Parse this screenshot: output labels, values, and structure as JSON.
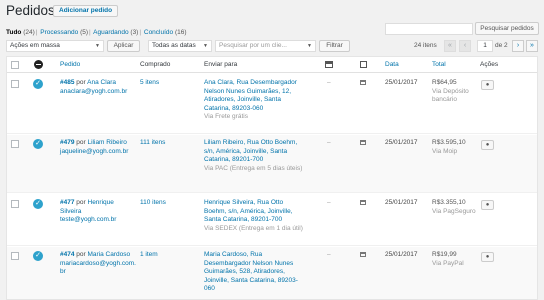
{
  "header": {
    "title": "Pedidos",
    "add_button": "Adicionar pedido"
  },
  "views": [
    {
      "label": "Tudo",
      "count": "(24)",
      "current": true
    },
    {
      "label": "Processando",
      "count": "(5)"
    },
    {
      "label": "Aguardando",
      "count": "(3)"
    },
    {
      "label": "Concluído",
      "count": "(16)"
    }
  ],
  "search": {
    "value": "",
    "button": "Pesquisar pedidos"
  },
  "tablenav": {
    "bulk_action": "Ações em massa",
    "apply": "Aplicar",
    "date_filter": "Todas as datas",
    "customer_placeholder": "Pesquisar por um clie...",
    "filter": "Filtrar",
    "items_count": "24 itens",
    "first": "«",
    "prev": "‹",
    "current_page": "1",
    "of_pages": "de 2",
    "next": "›",
    "last": "»"
  },
  "columns": {
    "order": "Pedido",
    "purchased": "Comprado",
    "ship_to": "Enviar para",
    "date": "Data",
    "total": "Total",
    "actions": "Ações"
  },
  "orders": [
    {
      "number": "#485",
      "by": "por",
      "customer": "Ana Clara",
      "email": "anaclara@yogh.com.br",
      "purchased": "5 itens",
      "address": "Ana Clara, Rua Desembargador Nelson Nunes Guimarães, 12, Atiradores, Joinville, Santa Catarina, 89203-060",
      "shipping": "Via Frete grátis",
      "billing": "–",
      "date": "25/01/2017",
      "total": "R$64,95",
      "payment": "Via Depósito bancário"
    },
    {
      "number": "#479",
      "by": "por",
      "customer": "Liliam Ribeiro",
      "email": "jaqueline@yogh.com.br",
      "purchased": "111 itens",
      "address": "Liliam Ribeiro, Rua Otto Boehm, s/n, América, Joinville, Santa Catarina, 89201-700",
      "shipping": "Via PAC (Entrega em 5 dias úteis)",
      "billing": "–",
      "date": "25/01/2017",
      "total": "R$3.595,10",
      "payment": "Via Moip"
    },
    {
      "number": "#477",
      "by": "por",
      "customer": "Henrique Silveira",
      "email": "teste@yogh.com.br",
      "purchased": "110 itens",
      "address": "Henrique Silveira, Rua Otto Boehm, s/n, América, Joinville, Santa Catarina, 89201-700",
      "shipping": "Via SEDEX (Entrega em 1 dia útil)",
      "billing": "–",
      "date": "25/01/2017",
      "total": "R$3.355,10",
      "payment": "Via PagSeguro"
    },
    {
      "number": "#474",
      "by": "por",
      "customer": "Maria Cardoso",
      "email": "mariacardoso@yogh.com.br",
      "purchased": "1 item",
      "address": "Maria Cardoso, Rua Desembargador Nelson Nunes Guimarães, 528, Atiradores, Joinville, Santa Catarina, 89203-060",
      "shipping": "",
      "billing": "–",
      "date": "25/01/2017",
      "total": "R$19,99",
      "payment": "Via PayPal"
    }
  ],
  "icons": {
    "status": "checkmark-icon",
    "billing_header": "billing-icon",
    "notes": "notes-icon",
    "view": "eye-icon"
  },
  "colors": {
    "link": "#0073aa",
    "status_completed": "#2ea2cc"
  }
}
